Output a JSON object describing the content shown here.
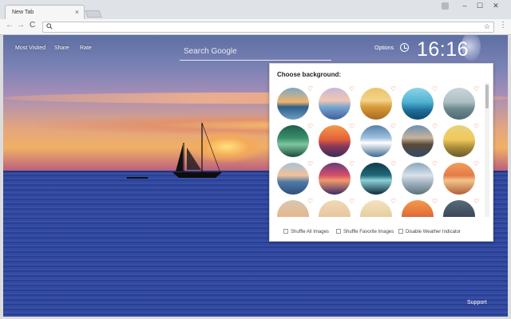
{
  "browser": {
    "tab_title": "New Tab",
    "tab_close": "×",
    "window_controls": [
      "–",
      "☐",
      "✕"
    ],
    "nav": {
      "back": "←",
      "forward": "→",
      "reload": "C"
    },
    "omnibox_value": "",
    "star": "☆",
    "menu": "⋮"
  },
  "page": {
    "nav_links": [
      "Most Visited",
      "Share",
      "Rate"
    ],
    "search_placeholder": "Search Google",
    "options_label": "Options",
    "time": "16:16",
    "support_label": "Support"
  },
  "panel": {
    "title": "Choose background:",
    "heart": "♡",
    "options": [
      {
        "label": "Shuffle All Images",
        "checked": false
      },
      {
        "label": "Shuffle Favorite Images",
        "checked": false
      },
      {
        "label": "Disable Weather Indicator",
        "checked": false
      }
    ]
  },
  "colors": {
    "heart": "#e56a4b",
    "panel_bg": "#ffffff",
    "sea": "#2e4296",
    "sunset": "#f0b066"
  }
}
